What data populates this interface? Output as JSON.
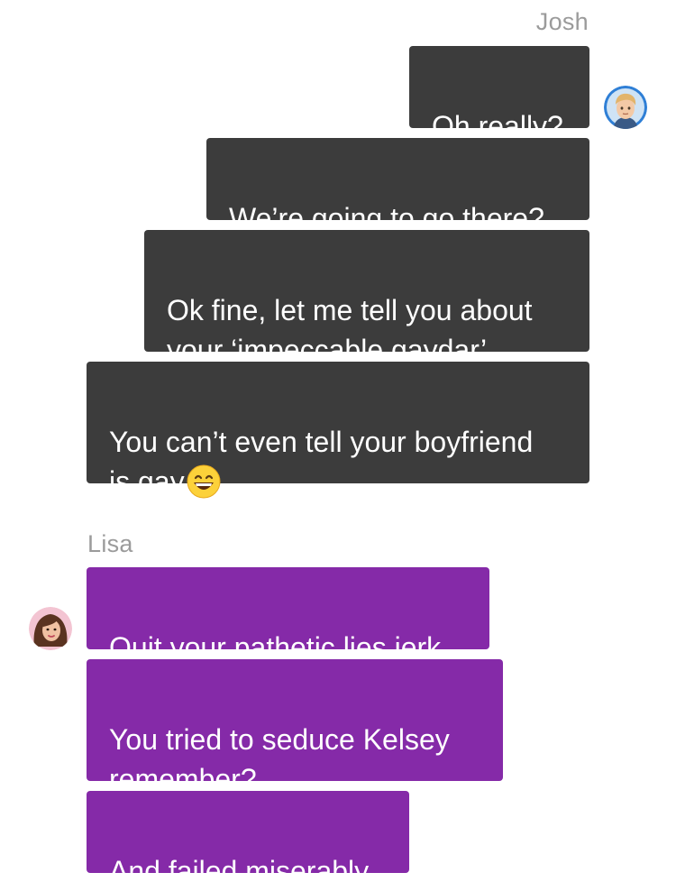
{
  "conversation": {
    "josh": {
      "name": "Josh",
      "avatar_icon": "boy-avatar-icon",
      "bubble_color": "#3c3c3c",
      "messages": [
        "Oh really?",
        "We’re going to go there?",
        "Ok fine, let me tell you about\nyour ‘impeccable gaydar’",
        "You can’t even tell your boyfriend\nis gay"
      ],
      "last_message_emoji": "grinning-face-icon"
    },
    "lisa": {
      "name": "Lisa",
      "avatar_icon": "girl-avatar-icon",
      "bubble_color": "#852aa8",
      "messages": [
        "Quit your pathetic lies jerk",
        "You tried to seduce Kelsey\nremember?",
        "And failed miserably"
      ]
    }
  }
}
